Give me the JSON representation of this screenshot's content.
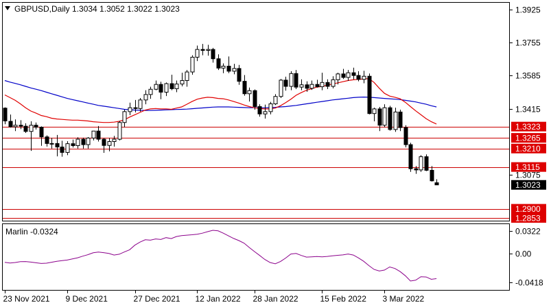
{
  "header": {
    "symbol_line": "GBPUSD,Daily  1.3034  1.3052  1.3022  1.3023"
  },
  "colors": {
    "candle": "#000000",
    "ma_fast": "#e00000",
    "ma_slow": "#0000c8",
    "level": "#cc0000",
    "level_label_bg": "#dd0000",
    "price_label_bg": "#000000",
    "marlin": "#8b008b"
  },
  "chart_data": {
    "type": "candlestick",
    "main": {
      "y_ticks": [
        "1.3925",
        "1.3755",
        "1.3585",
        "1.3415",
        "1.3075"
      ],
      "current_price": "1.3023",
      "levels": [
        "1.3323",
        "1.3265",
        "1.3210",
        "1.3115",
        "1.2900",
        "1.2853"
      ],
      "candles": [
        [
          1.3418,
          1.3422,
          1.3335,
          1.3352
        ],
        [
          1.335,
          1.3385,
          1.3318,
          1.3322
        ],
        [
          1.3322,
          1.336,
          1.33,
          1.333
        ],
        [
          1.333,
          1.3356,
          1.331,
          1.3325
        ],
        [
          1.3325,
          1.334,
          1.329,
          1.3298
        ],
        [
          1.3298,
          1.335,
          1.3198,
          1.333
        ],
        [
          1.333,
          1.3344,
          1.3308,
          1.332
        ],
        [
          1.332,
          1.3324,
          1.3224,
          1.327
        ],
        [
          1.327,
          1.3278,
          1.322,
          1.3236
        ],
        [
          1.3236,
          1.3265,
          1.321,
          1.3236
        ],
        [
          1.3236,
          1.328,
          1.317,
          1.3218
        ],
        [
          1.3218,
          1.325,
          1.3168,
          1.319
        ],
        [
          1.319,
          1.3248,
          1.3176,
          1.3235
        ],
        [
          1.3235,
          1.3256,
          1.3215,
          1.3225
        ],
        [
          1.3225,
          1.3268,
          1.321,
          1.3258
        ],
        [
          1.3258,
          1.3266,
          1.321,
          1.323
        ],
        [
          1.323,
          1.3269,
          1.321,
          1.3264
        ],
        [
          1.3264,
          1.33,
          1.3252,
          1.33
        ],
        [
          1.33,
          1.3326,
          1.3246,
          1.3258
        ],
        [
          1.3258,
          1.3264,
          1.3188,
          1.3226
        ],
        [
          1.3226,
          1.3264,
          1.3196,
          1.3246
        ],
        [
          1.3246,
          1.3275,
          1.322,
          1.3258
        ],
        [
          1.3258,
          1.3352,
          1.3252,
          1.3344
        ],
        [
          1.3344,
          1.341,
          1.332,
          1.34
        ],
        [
          1.34,
          1.3446,
          1.3382,
          1.342
        ],
        [
          1.342,
          1.346,
          1.3396,
          1.3416
        ],
        [
          1.3416,
          1.347,
          1.34,
          1.346
        ],
        [
          1.346,
          1.351,
          1.3438,
          1.3488
        ],
        [
          1.3488,
          1.3528,
          1.3466,
          1.3515
        ],
        [
          1.3515,
          1.356,
          1.351,
          1.354
        ],
        [
          1.354,
          1.3554,
          1.3464,
          1.35
        ],
        [
          1.35,
          1.355,
          1.348,
          1.3544
        ],
        [
          1.3544,
          1.359,
          1.351,
          1.3518
        ],
        [
          1.3518,
          1.356,
          1.35,
          1.3542
        ],
        [
          1.3542,
          1.36,
          1.353,
          1.356
        ],
        [
          1.356,
          1.3614,
          1.3528,
          1.3604
        ],
        [
          1.3604,
          1.369,
          1.359,
          1.368
        ],
        [
          1.368,
          1.374,
          1.366,
          1.372
        ],
        [
          1.372,
          1.3748,
          1.369,
          1.3715
        ],
        [
          1.3715,
          1.3744,
          1.3688,
          1.372
        ],
        [
          1.372,
          1.3728,
          1.3652,
          1.3672
        ],
        [
          1.3672,
          1.3695,
          1.3614,
          1.3624
        ],
        [
          1.3624,
          1.3648,
          1.3598,
          1.3634
        ],
        [
          1.3634,
          1.3684,
          1.3598,
          1.3608
        ],
        [
          1.3608,
          1.3646,
          1.3592,
          1.3622
        ],
        [
          1.3622,
          1.364,
          1.3538,
          1.3556
        ],
        [
          1.3556,
          1.3588,
          1.3482,
          1.3492
        ],
        [
          1.3492,
          1.3524,
          1.3452,
          1.3508
        ],
        [
          1.3508,
          1.3514,
          1.341,
          1.3426
        ],
        [
          1.3426,
          1.3438,
          1.3374,
          1.3388
        ],
        [
          1.3388,
          1.3436,
          1.3364,
          1.34
        ],
        [
          1.34,
          1.345,
          1.3386,
          1.344
        ],
        [
          1.344,
          1.349,
          1.3434,
          1.3478
        ],
        [
          1.3478,
          1.3568,
          1.347,
          1.3562
        ],
        [
          1.3562,
          1.358,
          1.3508,
          1.353
        ],
        [
          1.353,
          1.3608,
          1.351,
          1.3596
        ],
        [
          1.3596,
          1.3614,
          1.3516,
          1.3526
        ],
        [
          1.3526,
          1.3566,
          1.351,
          1.3538
        ],
        [
          1.3538,
          1.3556,
          1.3502,
          1.352
        ],
        [
          1.352,
          1.356,
          1.3512,
          1.354
        ],
        [
          1.354,
          1.3564,
          1.3524,
          1.3528
        ],
        [
          1.3528,
          1.36,
          1.351,
          1.355
        ],
        [
          1.355,
          1.3566,
          1.3516,
          1.353
        ],
        [
          1.353,
          1.3582,
          1.352,
          1.3564
        ],
        [
          1.3564,
          1.36,
          1.354,
          1.3594
        ],
        [
          1.3594,
          1.362,
          1.3568,
          1.3576
        ],
        [
          1.3576,
          1.3614,
          1.3558,
          1.36
        ],
        [
          1.36,
          1.3626,
          1.3566,
          1.3586
        ],
        [
          1.3586,
          1.3608,
          1.3556,
          1.3566
        ],
        [
          1.3566,
          1.361,
          1.3546,
          1.3582
        ],
        [
          1.3582,
          1.3596,
          1.3386,
          1.339
        ],
        [
          1.339,
          1.342,
          1.335,
          1.3414
        ],
        [
          1.3414,
          1.3424,
          1.33,
          1.333
        ],
        [
          1.333,
          1.3438,
          1.332,
          1.342
        ],
        [
          1.342,
          1.343,
          1.3302,
          1.3308
        ],
        [
          1.3308,
          1.342,
          1.3296,
          1.3398
        ],
        [
          1.3398,
          1.341,
          1.33,
          1.3318
        ],
        [
          1.3318,
          1.333,
          1.3216,
          1.323
        ],
        [
          1.323,
          1.324,
          1.309,
          1.3106
        ],
        [
          1.3106,
          1.312,
          1.308,
          1.31
        ],
        [
          1.31,
          1.3176,
          1.309,
          1.3168
        ],
        [
          1.3168,
          1.318,
          1.3094,
          1.3098
        ],
        [
          1.3098,
          1.312,
          1.304,
          1.3044
        ],
        [
          1.3034,
          1.3052,
          1.3022,
          1.3023
        ]
      ],
      "ma_fast": [
        1.3486,
        1.3472,
        1.3458,
        1.344,
        1.342,
        1.3403,
        1.3392,
        1.338,
        1.3374,
        1.3366,
        1.3362,
        1.336,
        1.3358,
        1.3356,
        1.3356,
        1.3354,
        1.3352,
        1.3348,
        1.3346,
        1.3344,
        1.3344,
        1.3346,
        1.335,
        1.3358,
        1.3372,
        1.3384,
        1.3396,
        1.3408,
        1.3414,
        1.3416,
        1.3414,
        1.3414,
        1.3412,
        1.3418,
        1.3424,
        1.3438,
        1.3452,
        1.3464,
        1.347,
        1.3474,
        1.3472,
        1.3468,
        1.3466,
        1.346,
        1.3452,
        1.3444,
        1.3434,
        1.3426,
        1.342,
        1.3416,
        1.3414,
        1.3414,
        1.3418,
        1.343,
        1.3446,
        1.3464,
        1.3484,
        1.3498,
        1.351,
        1.3518,
        1.3526,
        1.353,
        1.3536,
        1.3542,
        1.3548,
        1.3554,
        1.356,
        1.3564,
        1.3566,
        1.3568,
        1.357,
        1.355,
        1.352,
        1.3494,
        1.348,
        1.3474,
        1.3466,
        1.3448,
        1.3426,
        1.3404,
        1.3384,
        1.3364,
        1.3348,
        1.3336
      ],
      "ma_slow": [
        1.356,
        1.3552,
        1.3545,
        1.3538,
        1.353,
        1.3522,
        1.3515,
        1.3508,
        1.35,
        1.3492,
        1.3484,
        1.3476,
        1.3468,
        1.3462,
        1.3456,
        1.345,
        1.3444,
        1.3438,
        1.3432,
        1.3428,
        1.3424,
        1.342,
        1.3416,
        1.3412,
        1.341,
        1.3408,
        1.3407,
        1.3406,
        1.3406,
        1.3407,
        1.3408,
        1.3409,
        1.341,
        1.3411,
        1.3412,
        1.3413,
        1.3415,
        1.3417,
        1.3419,
        1.3421,
        1.3423,
        1.3424,
        1.3424,
        1.3424,
        1.3423,
        1.3422,
        1.3421,
        1.342,
        1.342,
        1.342,
        1.342,
        1.3421,
        1.3422,
        1.3424,
        1.3426,
        1.3429,
        1.3432,
        1.3436,
        1.344,
        1.3444,
        1.3448,
        1.3452,
        1.3456,
        1.346,
        1.3463,
        1.3466,
        1.3469,
        1.3472,
        1.3474,
        1.3475,
        1.3474,
        1.3472,
        1.347,
        1.3468,
        1.3466,
        1.3464,
        1.3462,
        1.3458,
        1.3454,
        1.345,
        1.3444,
        1.3438,
        1.343,
        1.3424
      ]
    },
    "oscillator": {
      "label": "Marlin -0.0324",
      "y_ticks": [
        "0.0322",
        "0.00",
        "-0.0418"
      ],
      "values": [
        -0.013,
        -0.014,
        -0.0132,
        -0.012,
        -0.0118,
        -0.0126,
        -0.0136,
        -0.0146,
        -0.0142,
        -0.0128,
        -0.0114,
        -0.0104,
        -0.0096,
        -0.008,
        -0.0064,
        -0.004,
        -0.0018,
        0.0008,
        0.0018,
        0.001,
        -0.0002,
        -0.0024,
        -0.0012,
        0.002,
        0.0052,
        0.0118,
        0.0162,
        0.0196,
        0.019,
        0.0208,
        0.02,
        0.0226,
        0.0212,
        0.0242,
        0.0256,
        0.0262,
        0.0268,
        0.0276,
        0.029,
        0.0312,
        0.0332,
        0.0324,
        0.029,
        0.0252,
        0.0214,
        0.0184,
        0.0146,
        0.0084,
        0.0026,
        -0.003,
        -0.0088,
        -0.0132,
        -0.015,
        -0.0118,
        -0.0068,
        -0.001,
        -0.0002,
        -0.003,
        -0.0054,
        -0.005,
        -0.0046,
        -0.005,
        -0.0044,
        -0.0036,
        -0.0028,
        -0.0022,
        -0.001,
        -0.0024,
        -0.0066,
        -0.0114,
        -0.0176,
        -0.0232,
        -0.0254,
        -0.024,
        -0.0196,
        -0.0218,
        -0.0262,
        -0.0322,
        -0.0398,
        -0.0386,
        -0.0336,
        -0.034,
        -0.0374,
        -0.0364
      ]
    },
    "x_axis": {
      "labels": [
        "23 Nov 2021",
        "9 Dec 2021",
        "27 Dec 2021",
        "12 Jan 2022",
        "28 Jan 2022",
        "15 Feb 2022",
        "3 Mar 2022"
      ],
      "label_bar_index": [
        0,
        12,
        25,
        37,
        48,
        61,
        73
      ]
    }
  }
}
